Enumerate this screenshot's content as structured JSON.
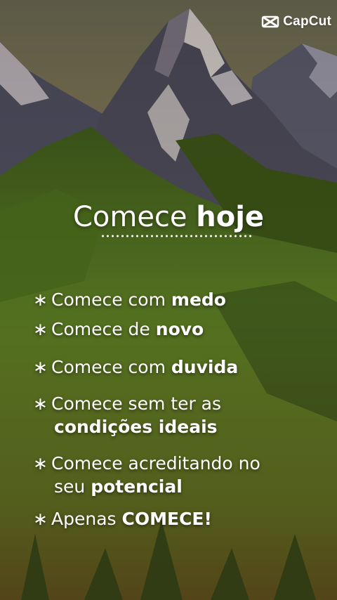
{
  "watermark": {
    "brand": "CapCut",
    "icon": "capcut-logo-icon"
  },
  "title": {
    "light": "Comece ",
    "bold": "hoje"
  },
  "bullet_glyph": "∗",
  "items": [
    {
      "light": "Comece com ",
      "bold": "medo"
    },
    {
      "light": "Comece de ",
      "bold": "novo"
    },
    {
      "light": "Comece com ",
      "bold": "duvida"
    },
    {
      "light": "Comece sem ter as",
      "bold": "condições ideais"
    },
    {
      "light": "Comece acreditando no",
      "light2": "seu ",
      "bold": "potencial"
    },
    {
      "light": "Apenas ",
      "bold": "COMECE!"
    }
  ],
  "colors": {
    "text": "#ffffff",
    "sky": "#7b6a45",
    "forest": "#4f6a1c"
  }
}
